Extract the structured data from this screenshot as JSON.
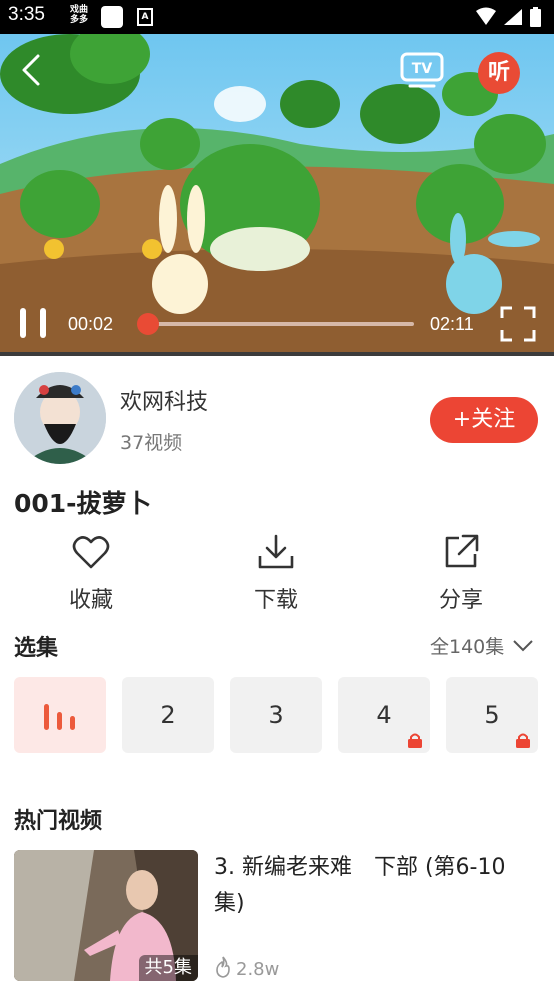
{
  "status_bar": {
    "time": "3:35",
    "app_badge": "戏曲\n多多",
    "a_badge": "A"
  },
  "player": {
    "current_time": "00:02",
    "total_time": "02:11",
    "progress": 0.015,
    "listen_label": "听",
    "tv_label": "TV"
  },
  "author": {
    "name": "欢网科技",
    "video_count": "37视频",
    "follow_label": "+关注"
  },
  "video": {
    "title": "001-拔萝卜"
  },
  "actions": [
    {
      "label": "收藏",
      "icon": "heart-icon"
    },
    {
      "label": "下载",
      "icon": "download-icon"
    },
    {
      "label": "分享",
      "icon": "share-icon"
    }
  ],
  "episodes": {
    "title": "选集",
    "all_label": "全140集",
    "items": [
      {
        "label": "",
        "state": "playing"
      },
      {
        "label": "2",
        "locked": false
      },
      {
        "label": "3",
        "locked": false
      },
      {
        "label": "4",
        "locked": true
      },
      {
        "label": "5",
        "locked": true
      }
    ]
  },
  "hot": {
    "title": "热门视频",
    "items": [
      {
        "title": "3. 新编老来难　下部 (第6-10集)",
        "badge": "共5集",
        "views": "2.8w"
      }
    ]
  },
  "colors": {
    "accent": "#ec4534",
    "active_episode_bg": "#fde8e6"
  }
}
